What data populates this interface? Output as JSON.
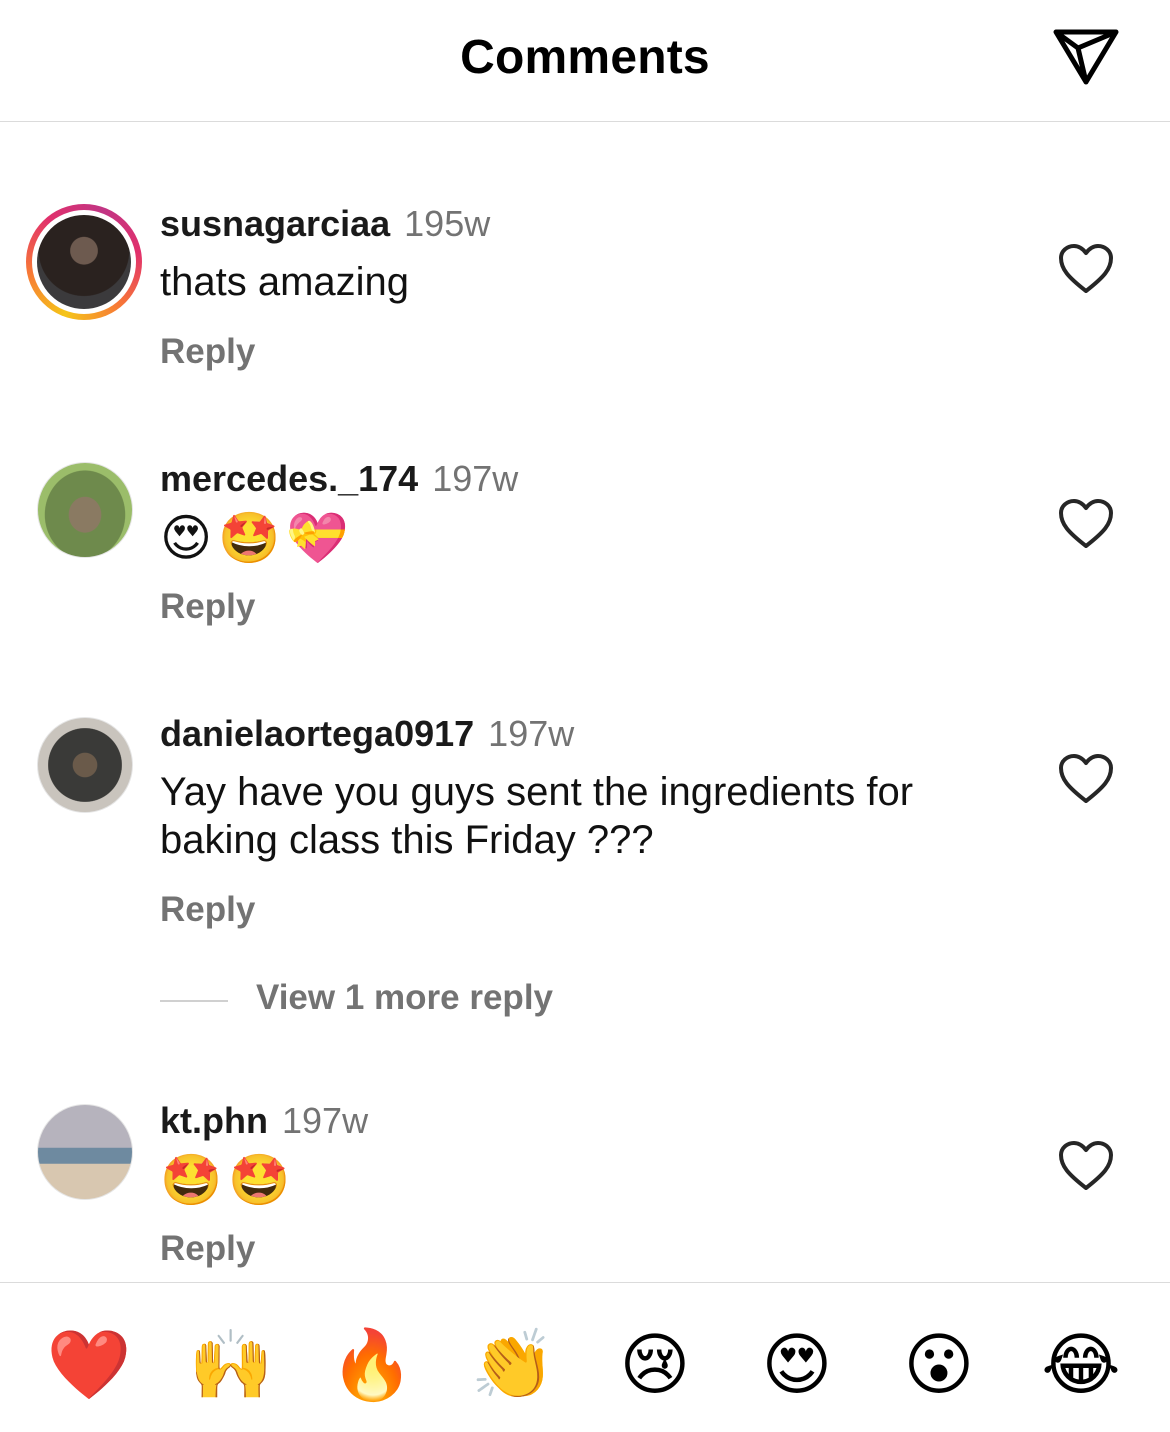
{
  "header": {
    "title": "Comments",
    "share_icon": "paper-plane-icon"
  },
  "comments": [
    {
      "username": "susnagarciaa",
      "time": "195w",
      "text": "thats amazing",
      "reply": "Reply",
      "has_story_ring": true
    },
    {
      "username": "mercedes._174",
      "time": "197w",
      "text": "😍🤩💝",
      "reply": "Reply",
      "has_story_ring": false
    },
    {
      "username": "danielaortega0917",
      "time": "197w",
      "text": "Yay have you guys sent the ingredients for baking class this Friday ???",
      "reply": "Reply",
      "has_story_ring": false,
      "more_replies": "View 1 more reply"
    },
    {
      "username": "kt.phn",
      "time": "197w",
      "text": "🤩🤩",
      "reply": "Reply",
      "has_story_ring": false
    }
  ],
  "reactions": [
    "❤️",
    "🙌",
    "🔥",
    "👏",
    "😢",
    "😍",
    "😮",
    "😂"
  ],
  "colors": {
    "secondary_text": "#737373",
    "divider": "#dbdbdb",
    "story_ring": [
      "#f5c518",
      "#e1306c",
      "#c13584"
    ]
  }
}
